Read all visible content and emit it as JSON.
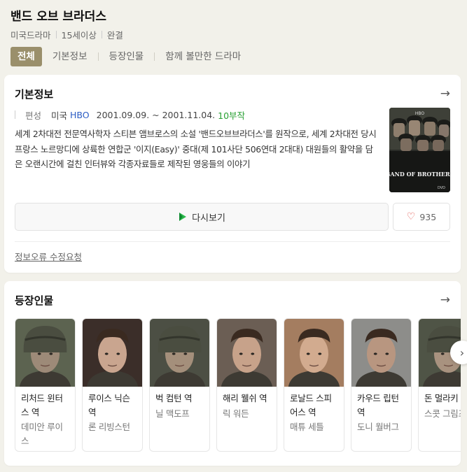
{
  "header": {
    "title": "밴드 오브 브라더스",
    "genre": "미국드라마",
    "rating": "15세이상",
    "status": "완결"
  },
  "tabs": [
    {
      "label": "전체",
      "active": true
    },
    {
      "label": "기본정보",
      "active": false
    },
    {
      "label": "등장인물",
      "active": false
    },
    {
      "label": "함께 볼만한 드라마",
      "active": false
    }
  ],
  "basic_info": {
    "title": "기본정보",
    "arrow_icon": "arrow-right-icon",
    "schedule_label": "편성",
    "country": "미국",
    "network": "HBO",
    "period": "2001.09.09. ~ 2001.11.04.",
    "episodes": "10부작",
    "description": "세계 2차대전 전문역사학자 스티븐 앰브로스의 소설 '밴드오브브라더스'를 원작으로, 세계 2차대전 당시 프랑스 노르망디에 상륙한 연합군 '이지(Easy)' 중대(제 101사단 506연대 2대대) 대원들의 활약을 담은 오랜시간에 걸친 인터뷰와 각종자료들로 제작된 영웅들의 이야기",
    "poster_text": "BAND OF BROTHERS",
    "poster_top_text": "HBO",
    "poster_bottom_text": "DVD",
    "watch_label": "다시보기",
    "like_count": "935",
    "report_label": "정보오류 수정요청"
  },
  "cast": {
    "title": "등장인물",
    "arrow_icon": "arrow-right-icon",
    "members": [
      {
        "role": "리처드 윈터스 역",
        "actor": "데미안 루이스",
        "helmet": true,
        "skin": "#9d8a78",
        "bg": "#5c6350"
      },
      {
        "role": "루이스 닉슨 역",
        "actor": "론 리빙스턴",
        "helmet": false,
        "skin": "#c9a58f",
        "bg": "#3b2e29"
      },
      {
        "role": "벅 컴턴 역",
        "actor": "닐 맥도프",
        "helmet": true,
        "skin": "#a48f7b",
        "bg": "#4c4f44"
      },
      {
        "role": "해리 웰쉬 역",
        "actor": "릭 워든",
        "helmet": false,
        "skin": "#c7a28a",
        "bg": "#6b5e54"
      },
      {
        "role": "로날드 스피어스 역",
        "actor": "매튜 세틀",
        "helmet": false,
        "skin": "#d2ab8f",
        "bg": "#a47d60"
      },
      {
        "role": "카우드 립턴 역",
        "actor": "도니 월버그",
        "helmet": false,
        "skin": "#b89680",
        "bg": "#8d8d8a"
      },
      {
        "role": "돈 멀라키 역",
        "actor": "스콧 그림즈",
        "helmet": true,
        "skin": "#a8927f",
        "bg": "#4f5446"
      }
    ],
    "next_icon": "chevron-right-icon"
  }
}
